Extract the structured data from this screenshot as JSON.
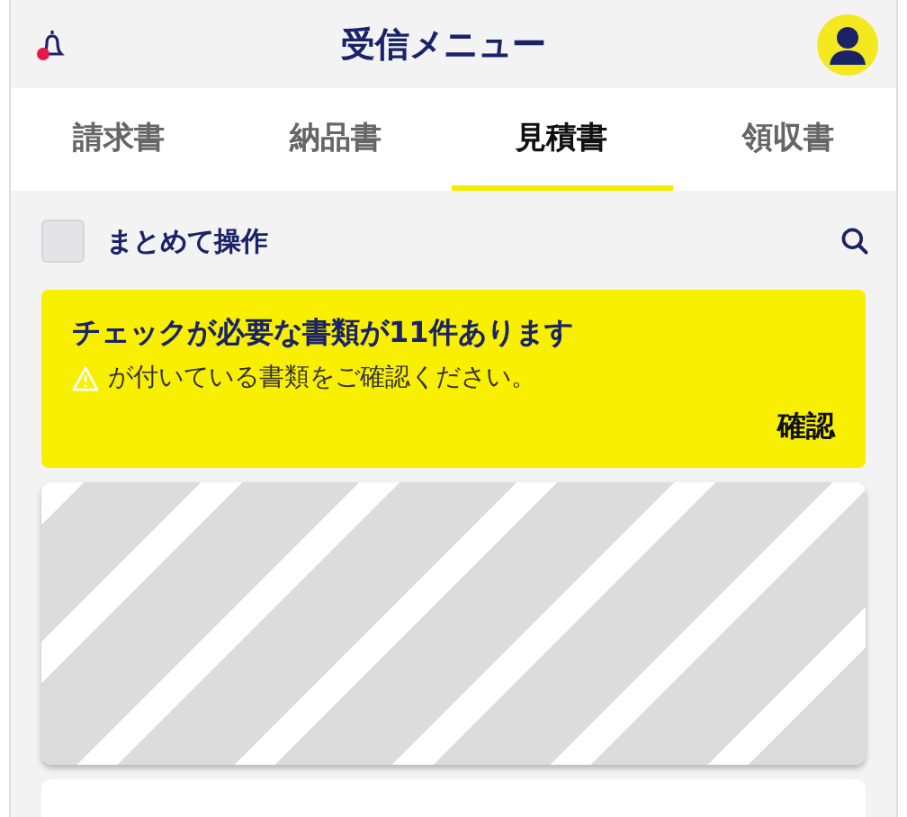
{
  "header": {
    "title": "受信メニュー"
  },
  "tabs": [
    {
      "label": "請求書",
      "selected": false
    },
    {
      "label": "納品書",
      "selected": false
    },
    {
      "label": "見積書",
      "selected": true
    },
    {
      "label": "領収書",
      "selected": false
    }
  ],
  "toolbar": {
    "bulk_label": "まとめて操作",
    "checked": false
  },
  "notice": {
    "title": "チェックが必要な書類が11件あります",
    "message": "が付いている書類をご確認ください。",
    "action": "確認"
  },
  "cards": [
    {
      "kind": "loading"
    },
    {
      "kind": "blank"
    }
  ]
}
